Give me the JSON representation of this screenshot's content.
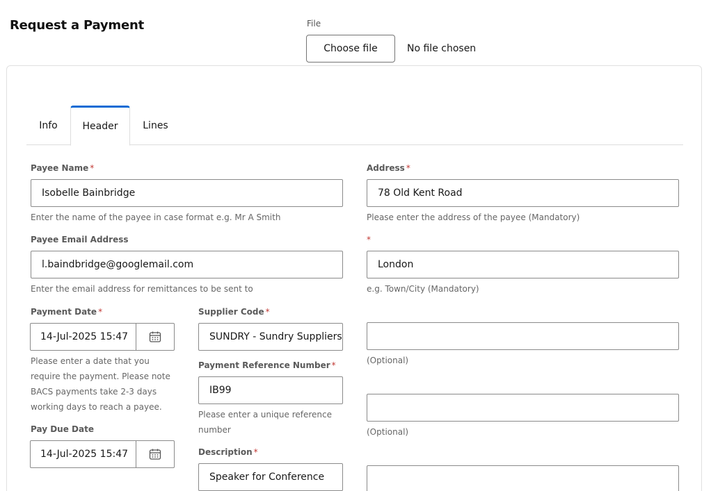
{
  "page": {
    "title": "Request a Payment"
  },
  "file": {
    "label": "File",
    "button_label": "Choose file",
    "status": "No file chosen"
  },
  "tabs": [
    {
      "label": "Info",
      "active": false
    },
    {
      "label": "Header",
      "active": true
    },
    {
      "label": "Lines",
      "active": false
    }
  ],
  "form": {
    "required_mark": "*",
    "payee_name": {
      "label": "Payee Name",
      "value": "Isobelle Bainbridge",
      "help": "Enter the name of the payee in case format e.g. Mr A Smith"
    },
    "payee_email": {
      "label": "Payee Email Address",
      "value": "l.baindbridge@googlemail.com",
      "help": "Enter the email address for remittances to be sent to"
    },
    "payment_date": {
      "label": "Payment Date",
      "value": "14-Jul-2025 15:47",
      "help_lines": [
        "Please enter a date that you",
        "require the payment. Please note",
        "BACS payments take 2-3 days",
        "working days to reach a payee."
      ]
    },
    "pay_due_date": {
      "label": "Pay Due Date",
      "value": "14-Jul-2025 15:47"
    },
    "supplier_code": {
      "label": "Supplier Code",
      "value": "SUNDRY - Sundry Suppliers"
    },
    "payment_reference": {
      "label": "Payment Reference Number",
      "value": "IB99",
      "help_lines": [
        "Please enter a unique reference",
        "number"
      ]
    },
    "description": {
      "label": "Description",
      "value": "Speaker for Conference"
    },
    "address": {
      "label": "Address",
      "line1": "78 Old Kent Road",
      "help1": "Please enter the address of the payee (Mandatory)",
      "line2": "London",
      "help2": "e.g. Town/City (Mandatory)",
      "line3": "",
      "help3": "(Optional)",
      "line4": "",
      "help4": "(Optional)",
      "line5": ""
    }
  },
  "icons": {
    "calendar": "calendar-icon"
  },
  "colors": {
    "tab_active_accent": "#0b6ad4",
    "required": "#c23934"
  }
}
